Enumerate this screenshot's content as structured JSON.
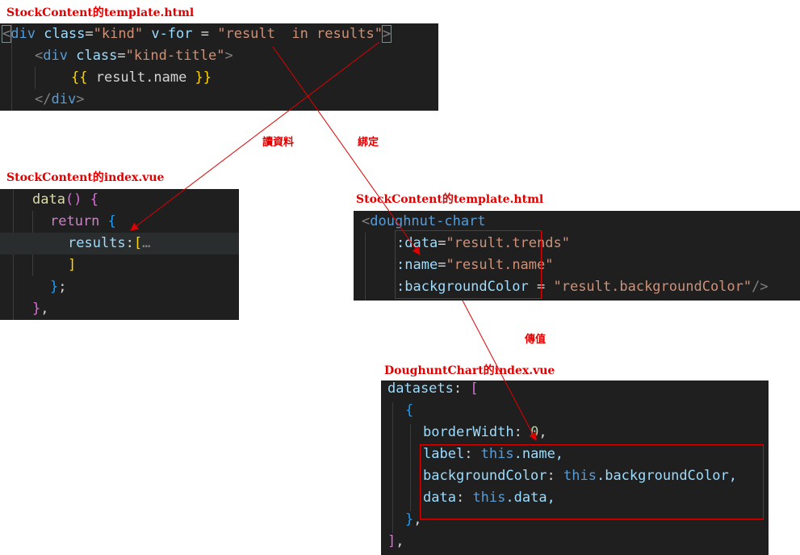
{
  "captions": {
    "top": "StockContent的template.html",
    "left": "StockContent的index.vue",
    "mid": "StockContent的template.html",
    "bottom": "DoughuntChart的index.vue"
  },
  "labels": {
    "read": "讀資料",
    "bind": "綁定",
    "pass": "傳值"
  },
  "panel_template1": {
    "l1_open": "<",
    "l1_tag": "div",
    "l1_attr1": "class",
    "l1_eq1": "=",
    "l1_val1": "\"kind\"",
    "l1_attr2": "v-for",
    "l1_eq2": " = ",
    "l1_val2": "\"result  in results\"",
    "l1_close": ">",
    "l2_open": "<",
    "l2_tag": "div",
    "l2_attr": "class",
    "l2_eq": "=",
    "l2_val": "\"kind-title\"",
    "l2_close": ">",
    "l3_open": "{{",
    "l3_text": " result.name ",
    "l3_close": "}}",
    "l4_open": "</",
    "l4_tag": "div",
    "l4_close": ">"
  },
  "panel_index": {
    "l1_fn": "data",
    "l1_paren": "()",
    "l1_brace": "{",
    "l2_kw": "return",
    "l2_brace": "{",
    "l3_key": "results",
    "l3_colon": ":",
    "l3_bracket": "[",
    "l3_ellipsis": "…",
    "l4_bracket": "]",
    "l5_brace": "}",
    "l5_semi": ";",
    "l6_brace": "}",
    "l6_comma": ","
  },
  "panel_template2": {
    "l1_open": "<",
    "l1_tag": "doughnut-chart",
    "l2_attr": ":data",
    "l2_eq": "=",
    "l2_val": "\"result.trends\"",
    "l3_attr": ":name",
    "l3_eq": "=",
    "l3_val": "\"result.name\"",
    "l4_attr": ":backgroundColor",
    "l4_eq": " = ",
    "l4_val": "\"result.backgroundColor\"",
    "l4_close": "/>"
  },
  "panel_chart": {
    "l1_key": "datasets",
    "l1_colon": ": ",
    "l1_bracket": "[",
    "l2_brace": "{",
    "l3_key": "borderWidth",
    "l3_colon": ": ",
    "l3_num": "0",
    "l3_comma": ",",
    "l4_key": "label",
    "l4_colon": ": ",
    "l4_this": "this",
    "l4_prop": ".name,",
    "l5_key": "backgroundColor",
    "l5_colon": ": ",
    "l5_this": "this",
    "l5_prop": ".backgroundColor,",
    "l6_key": "data",
    "l6_colon": ": ",
    "l6_this": "this",
    "l6_prop": ".data,",
    "l7_brace": "}",
    "l7_comma": ",",
    "l8_bracket": "]",
    "l8_comma": ","
  },
  "colors": {
    "annotation": "#e00000",
    "panel_bg": "#1f1f1f",
    "tag": "#569cd6",
    "attribute": "#9cdcfe",
    "string": "#ce9178"
  }
}
